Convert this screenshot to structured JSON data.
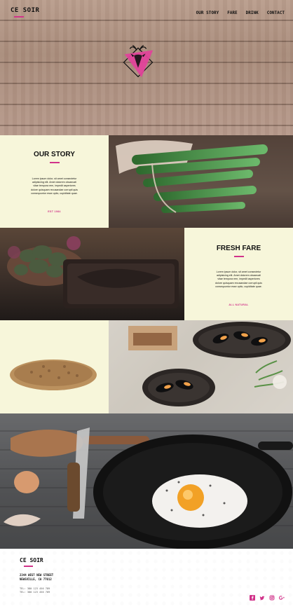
{
  "brand": {
    "name": "CE SOIR"
  },
  "nav": {
    "items": [
      "OUR STORY",
      "FARE",
      "DRINK",
      "CONTACT"
    ]
  },
  "sections": {
    "our_story": {
      "title": "OUR STORY",
      "body": "Lorem ipsum dolor, sit amet consectetur adipisicing elit. Amet dolorem obcaecati vitae tempora rem, impedit asperiores dolore quisquam recusandae corrupti quis consequuntur esse optio, cupiditate quae.",
      "tagline": "EST 1984"
    },
    "fresh_fare": {
      "title": "FRESH FARE",
      "body": "Lorem ipsum dolor, sit amet consectetur adipisicing elit. Amet dolorem obcaecati vitae tempora rem, impedit asperiores dolore quisquam recusandae corrupti quis consequuntur esse optio, cupiditate quae.",
      "tagline": "ALL NATURAL"
    }
  },
  "footer": {
    "brand": "CE SOIR",
    "address_lines": [
      "2344 WEST NEW STREET",
      "NEWSVILLE, CA 77012"
    ],
    "phone_lines": [
      "TEL: 380 123 456 789",
      "TEL: 380 123 456 789"
    ],
    "social_icons": [
      "facebook-icon",
      "twitter-icon",
      "instagram-icon",
      "google-plus-icon"
    ]
  },
  "colors": {
    "accent": "#d1338a",
    "cream": "#f7f6da"
  }
}
